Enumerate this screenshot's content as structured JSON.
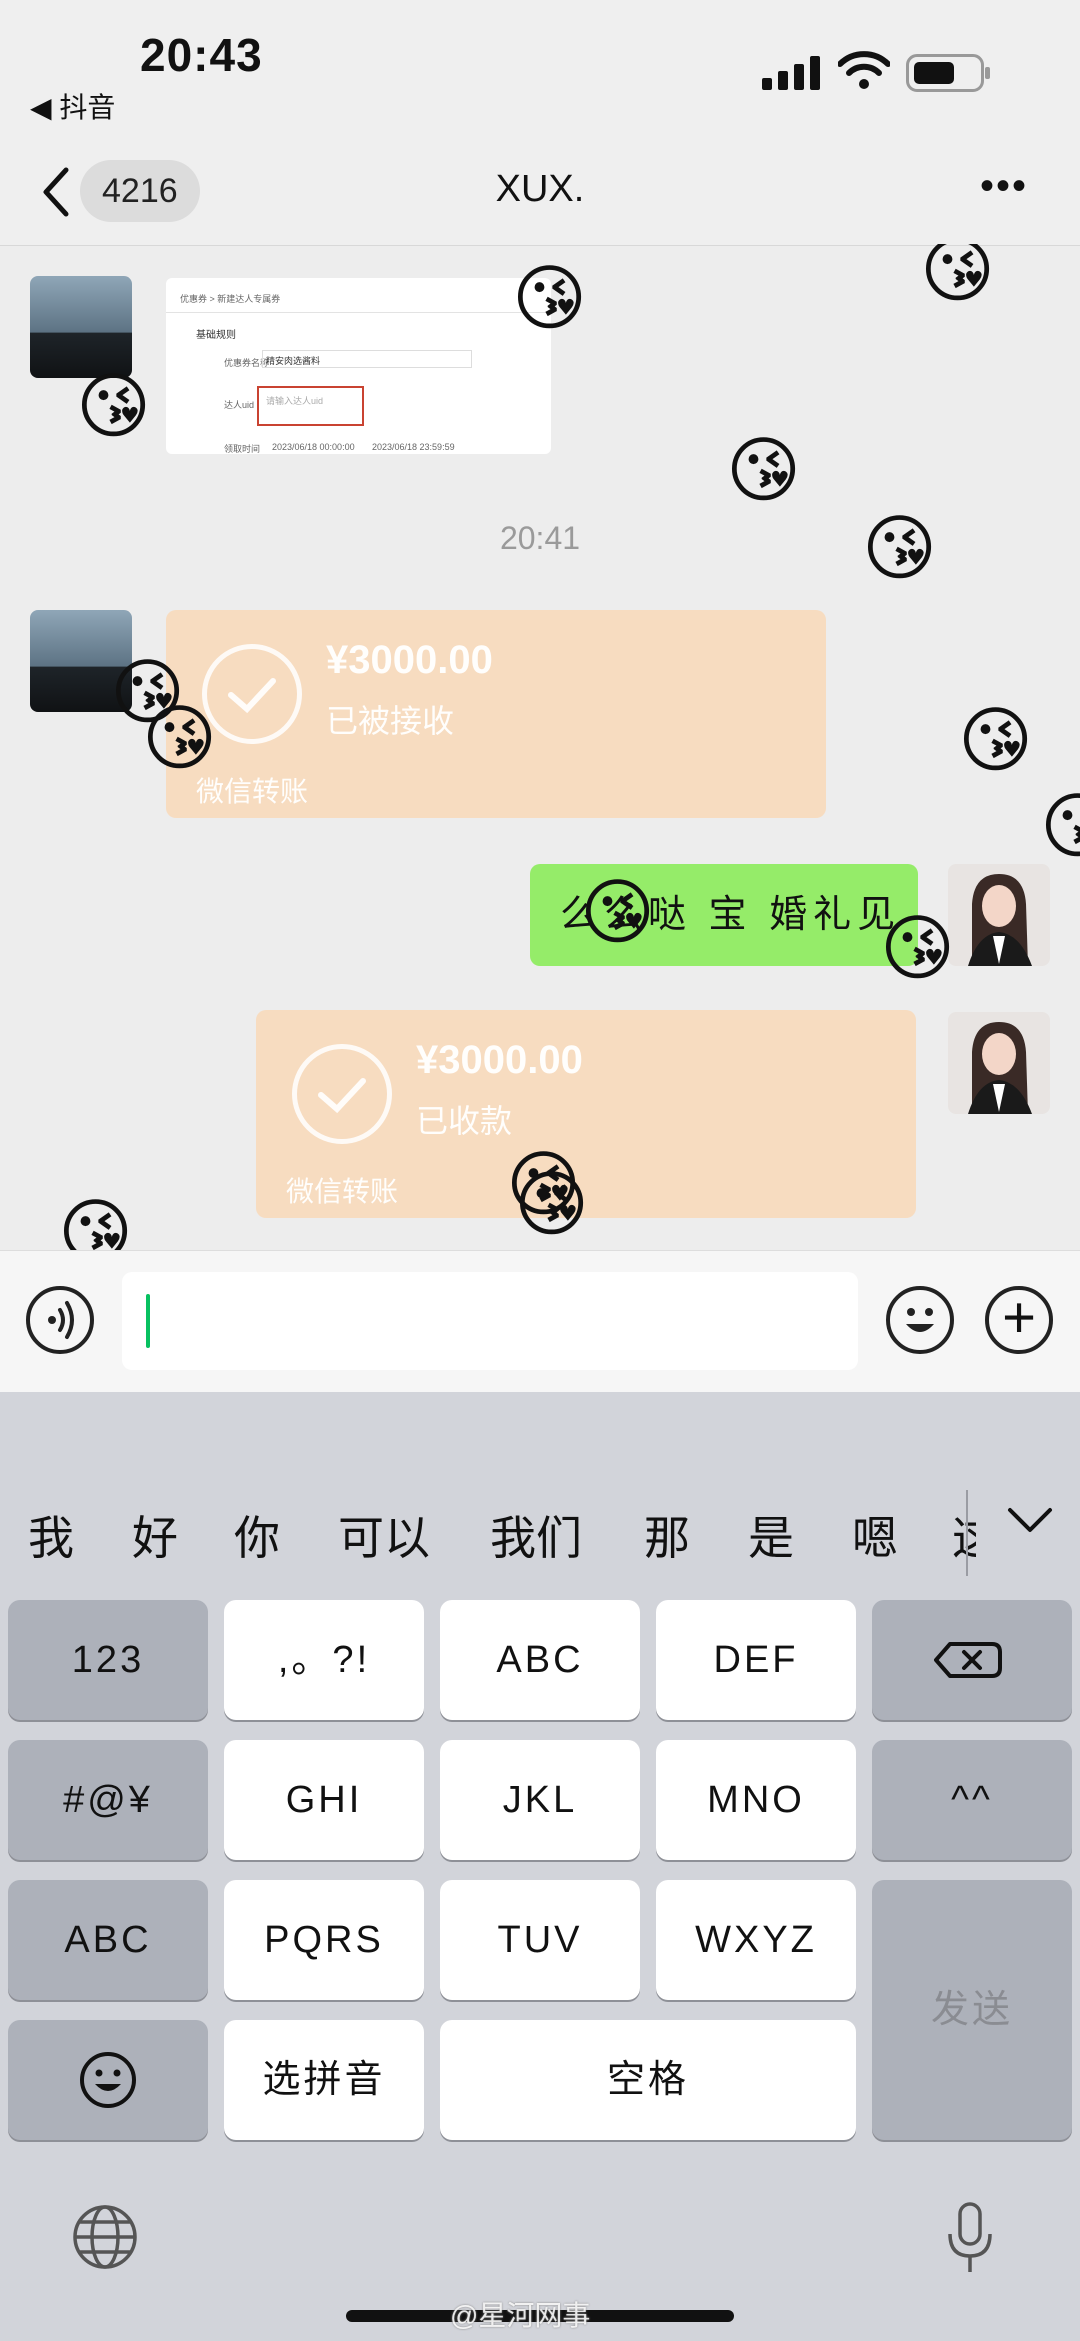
{
  "status_bar": {
    "time": "20:43",
    "back_app": "◀ 抖音"
  },
  "nav": {
    "unread_badge": "4216",
    "title": "XUX.",
    "more": "•••"
  },
  "chat": {
    "screenshot_card": {
      "breadcrumb": "优惠券 > 新建达人专属券",
      "section": "基础规则",
      "row1_label": "优惠券名称",
      "row1_value": "精安肉选酱料",
      "row2_label": "达人uid",
      "row2_placeholder": "请输入达人uid",
      "row3_label": "领取时间",
      "row3_start": "2023/06/18 00:00:00",
      "row3_end": "2023/06/18 23:59:59"
    },
    "timestamp": "20:41",
    "transfer_1": {
      "amount": "¥3000.00",
      "status": "已被接收",
      "footer": "微信转账"
    },
    "text_message": "么么哒 宝 婚礼见",
    "transfer_2": {
      "amount": "¥3000.00",
      "status": "已收款",
      "footer": "微信转账"
    }
  },
  "keyboard": {
    "candidates": [
      "我",
      "好",
      "你",
      "可以",
      "我们",
      "那",
      "是",
      "嗯",
      "这"
    ],
    "rows": [
      [
        "123",
        ",。?!",
        "ABC",
        "DEF"
      ],
      [
        "#@¥",
        "GHI",
        "JKL",
        "MNO",
        "^^"
      ],
      [
        "ABC",
        "PQRS",
        "TUV",
        "WXYZ"
      ],
      [
        "选拼音",
        "空格",
        "发送"
      ]
    ]
  },
  "watermark": "@星河网事",
  "colors": {
    "accent_green": "#95ec69",
    "transfer_bg": "#f7dcc0",
    "caret": "#07c160"
  }
}
